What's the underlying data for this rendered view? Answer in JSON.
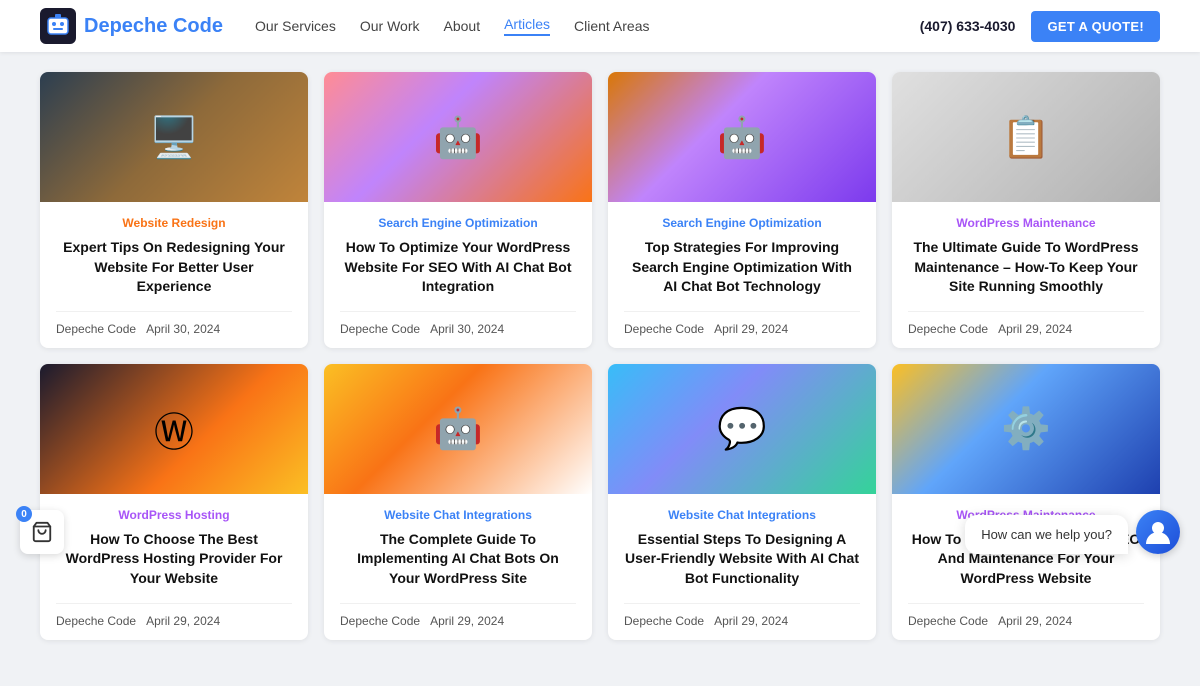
{
  "header": {
    "logo_name": "Depeche",
    "logo_name2": "Code",
    "nav_items": [
      {
        "label": "Our Services",
        "active": false
      },
      {
        "label": "Our Work",
        "active": false
      },
      {
        "label": "About",
        "active": false
      },
      {
        "label": "Articles",
        "active": true
      },
      {
        "label": "Client Areas",
        "active": false
      }
    ],
    "phone": "(407) 633-4030",
    "cta_label": "GET A QUOTE!"
  },
  "cards_row1": [
    {
      "category": "Website Redesign",
      "category_class": "cat-website-redesign",
      "title": "Expert Tips On Redesigning Your Website For Better User Experience",
      "author": "Depeche Code",
      "date": "April 30, 2024",
      "img_class": "img-website-redesign",
      "img_icon": "🖥️"
    },
    {
      "category": "Search Engine Optimization",
      "category_class": "cat-seo",
      "title": "How To Optimize Your WordPress Website For SEO With AI Chat Bot Integration",
      "author": "Depeche Code",
      "date": "April 30, 2024",
      "img_class": "img-seo-chatbot1",
      "img_icon": "🤖"
    },
    {
      "category": "Search Engine Optimization",
      "category_class": "cat-seo",
      "title": "Top Strategies For Improving Search Engine Optimization With AI Chat Bot Technology",
      "author": "Depeche Code",
      "date": "April 29, 2024",
      "img_class": "img-seo-chatbot2",
      "img_icon": "🤖"
    },
    {
      "category": "WordPress Maintenance",
      "category_class": "cat-wp-maintenance",
      "title": "The Ultimate Guide To WordPress Maintenance – How-To Keep Your Site Running Smoothly",
      "author": "Depeche Code",
      "date": "April 29, 2024",
      "img_class": "img-wp-maintenance",
      "img_icon": "📋"
    }
  ],
  "cards_row2": [
    {
      "category": "WordPress Hosting",
      "category_class": "cat-wp-hosting",
      "title": "How To Choose The Best WordPress Hosting Provider For Your Website",
      "author": "Depeche Code",
      "date": "April 29, 2024",
      "img_class": "img-wp-hosting",
      "img_icon": "Ⓦ"
    },
    {
      "category": "Website Chat Integrations",
      "category_class": "cat-chat-integrations",
      "title": "The Complete Guide To Implementing AI Chat Bots On Your WordPress Site",
      "author": "Depeche Code",
      "date": "April 29, 2024",
      "img_class": "img-chat-bots",
      "img_icon": "🤖"
    },
    {
      "category": "Website Chat Integrations",
      "category_class": "cat-chat-integrations",
      "title": "Essential Steps To Designing A User-Friendly Website With AI Chat Bot Functionality",
      "author": "Depeche Code",
      "date": "April 29, 2024",
      "img_class": "img-ai-chat-func",
      "img_icon": "💬"
    },
    {
      "category": "WordPress Maintenance",
      "category_class": "cat-wp-maintenance",
      "title": "How To Successfully Manage SEO And Maintenance For Your WordPress Website",
      "author": "Depeche Code",
      "date": "April 29, 2024",
      "img_class": "img-seo-manage",
      "img_icon": "⚙️"
    }
  ],
  "chat": {
    "bubble_text": "How can we help you?",
    "avatar_icon": "👤",
    "badge_count": "0"
  }
}
